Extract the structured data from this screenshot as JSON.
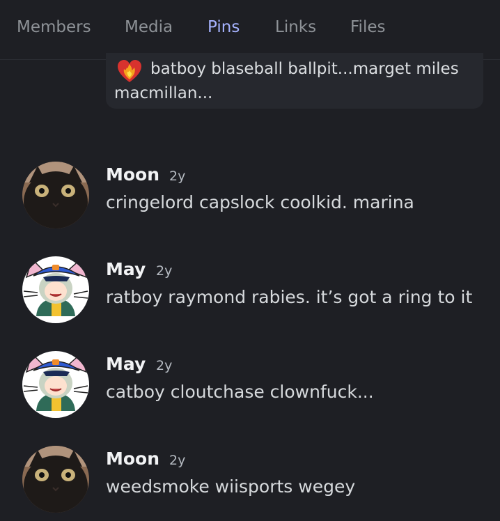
{
  "tabs": [
    {
      "label": "Members",
      "active": false
    },
    {
      "label": "Media",
      "active": false
    },
    {
      "label": "Pins",
      "active": true
    },
    {
      "label": "Links",
      "active": false
    },
    {
      "label": "Files",
      "active": false
    }
  ],
  "preview": {
    "emoji_icon": "heart-fire-emoji-icon",
    "text": "batboy blaseball ballpit...marget miles macmillan..."
  },
  "messages": [
    {
      "author": "Moon",
      "time": "2y",
      "text": "cringelord capslock coolkid. marina",
      "avatar": "black-cat-avatar"
    },
    {
      "author": "May",
      "time": "2y",
      "text": "ratboy raymond rabies. it’s got a ring to it",
      "avatar": "anime-catboy-avatar"
    },
    {
      "author": "May",
      "time": "2y",
      "text": "catboy cloutchase clownfuck...",
      "avatar": "anime-catboy-avatar"
    },
    {
      "author": "Moon",
      "time": "2y",
      "text": "weedsmoke wiisports wegey",
      "avatar": "black-cat-avatar"
    }
  ],
  "colors": {
    "background": "#1e1f24",
    "accent": "#a6b3ff",
    "muted": "#8e9297",
    "card": "#26282e"
  }
}
